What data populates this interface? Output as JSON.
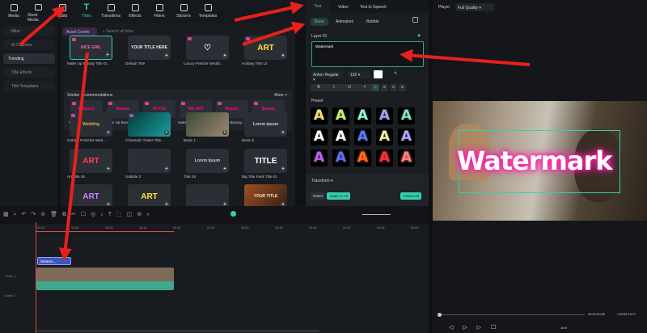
{
  "nav": [
    {
      "label": "Media",
      "icon": "media-icon"
    },
    {
      "label": "Stock Media",
      "icon": "stock-media-icon"
    },
    {
      "label": "Audio",
      "icon": "music-icon"
    },
    {
      "label": "Titles",
      "icon": "text-t-icon"
    },
    {
      "label": "Transitions",
      "icon": "transitions-icon"
    },
    {
      "label": "Effects",
      "icon": "effects-icon"
    },
    {
      "label": "Filters",
      "icon": "filters-icon"
    },
    {
      "label": "Stickers",
      "icon": "stickers-icon"
    },
    {
      "label": "Templates",
      "icon": "templates-icon"
    }
  ],
  "sidebar": [
    "Mine",
    "AI Captions",
    "Trending",
    "Title Effects",
    "Title Templates"
  ],
  "library": {
    "asset_center": "Asset Center",
    "search_placeholder": "Search all titles",
    "filter": "All",
    "row1": [
      {
        "label": "Make Up Beauty Title 01",
        "art": "NICE GIRL"
      },
      {
        "label": "Default Title",
        "art": "YOUR TITLE HERE"
      },
      {
        "label": "Luxury Particle Weddi...",
        "art": "♡"
      },
      {
        "label": "Holiday Title 12",
        "art": "ART"
      }
    ],
    "rec_title": "Similar recommendations",
    "more": "More >",
    "rec": [
      "Make Up Beauty...",
      "Make Up Beauty...",
      "Make Up Beauty...",
      "Make Up Beauty...",
      "Make Up Beauty...",
      "Make Up Title 01"
    ],
    "rec_art": [
      "5 Beauty",
      "Beauty",
      "STYLE",
      "WE ART",
      "Beauty",
      "Beauty"
    ],
    "row2": [
      {
        "label": "Golden Particles Wed...",
        "art": "Wedding"
      },
      {
        "label": "Cinematic Trailer Title...",
        "art": ""
      },
      {
        "label": "Basic 1",
        "art": ""
      },
      {
        "label": "Basic 6",
        "art": "Lorem ipsum"
      }
    ],
    "row3": [
      {
        "label": "Art Title 26",
        "art": "ART"
      },
      {
        "label": "Subtitle 2",
        "art": ""
      },
      {
        "label": "Title 29",
        "art": "Lorem Ipsum"
      },
      {
        "label": "Big Title Pack Title 01",
        "art": "TITLE"
      }
    ],
    "row4": [
      {
        "label": "",
        "art": "ART"
      },
      {
        "label": "",
        "art": "ART"
      },
      {
        "label": "",
        "art": ""
      },
      {
        "label": "",
        "art": "YOUR TITLE"
      }
    ]
  },
  "text_panel": {
    "tabs": [
      "Text",
      "Video",
      "Text to Speech"
    ],
    "subtabs": [
      "Basic",
      "Animation",
      "Bubble"
    ],
    "layer": "Layer 01",
    "text": "Watermark",
    "font": "Anton Regular",
    "size": "192",
    "format": [
      "B",
      "I",
      "U",
      "ᴬ",
      "≡",
      "≡",
      "≡",
      "≡"
    ],
    "preset": "Preset",
    "transform": "Transform",
    "reset": "Reset",
    "apply_all": "Apply to All",
    "advanced": "Advanced"
  },
  "player": {
    "label": "Player",
    "quality": "Full Quality",
    "watermark": "Watermark",
    "current": "00:00:00:00",
    "total": "/ 00:00:19:17",
    "ratio": "16:9"
  },
  "timeline": {
    "ticks": [
      "00:00",
      "00:04",
      "00:09",
      "00:14",
      "00:19",
      "00:24",
      "00:29",
      "00:33",
      "00:38",
      "00:43",
      "00:48",
      "00:53"
    ],
    "title_clip": "Waterm...",
    "tracks": [
      "",
      "Video 1",
      "Audio 1"
    ]
  },
  "colors": {
    "accent": "#35d0b0",
    "annotation": "#e8201c",
    "glow": "#ff1fa8"
  }
}
